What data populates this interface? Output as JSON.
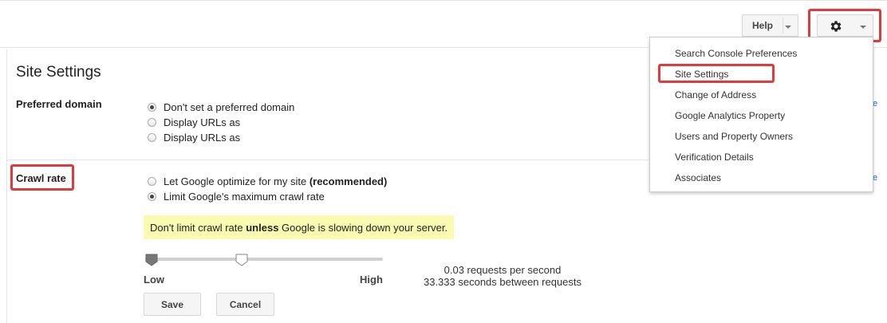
{
  "toolbar": {
    "help_label": "Help",
    "settings_icon": "gear-icon"
  },
  "settings_menu": {
    "items": [
      {
        "label": "Search Console Preferences"
      },
      {
        "label": "Site Settings"
      },
      {
        "label": "Change of Address"
      },
      {
        "label": "Google Analytics Property"
      },
      {
        "label": "Users and Property Owners"
      },
      {
        "label": "Verification Details"
      },
      {
        "label": "Associates"
      }
    ]
  },
  "page": {
    "title": "Site Settings"
  },
  "preferred_domain": {
    "label": "Preferred domain",
    "options": [
      {
        "label": "Don't set a preferred domain",
        "selected": true
      },
      {
        "label": "Display URLs as",
        "selected": false
      },
      {
        "label": "Display URLs as",
        "selected": false
      }
    ]
  },
  "crawl_rate": {
    "label": "Crawl rate",
    "option1_text": "Let Google optimize for my site ",
    "option1_bold": "(recommended)",
    "option2_text": "Limit Google's maximum crawl rate",
    "selected_option": 2,
    "warning_pre": "Don't limit crawl rate ",
    "warning_bold": "unless",
    "warning_post": " Google is slowing down your server.",
    "slider": {
      "low_label": "Low",
      "high_label": "High",
      "value_fraction": 0.4
    },
    "requests_per_second": "0.03 requests per second",
    "seconds_between": "33.333 seconds between requests",
    "save_label": "Save",
    "cancel_label": "Cancel"
  },
  "colors": {
    "highlight": "#e03b3b",
    "warning_bg": "#fafab0",
    "link": "#1a66c8"
  }
}
